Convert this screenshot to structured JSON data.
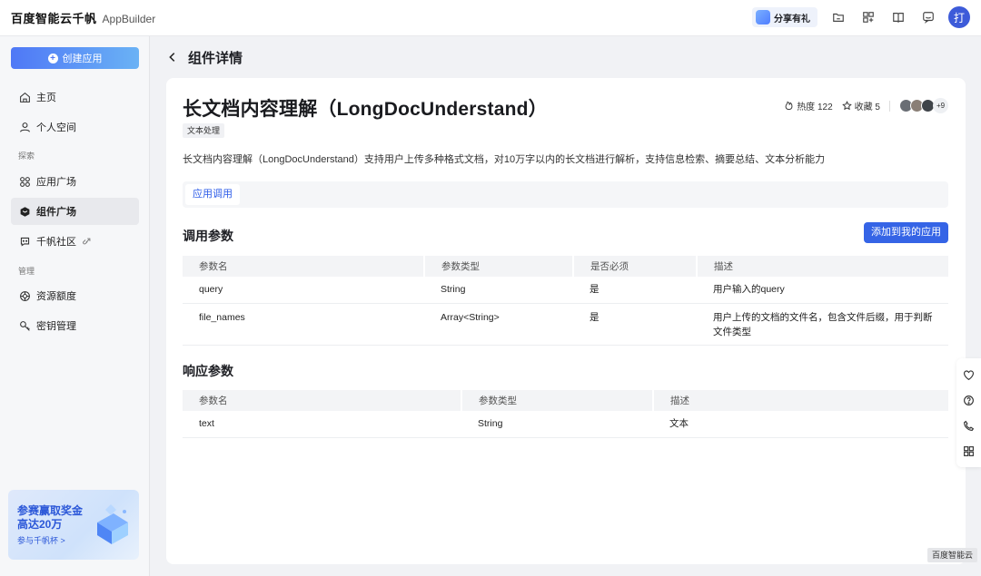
{
  "topbar": {
    "logo_main": "百度智能云千帆",
    "logo_sub": "AppBuilder",
    "share_label": "分享有礼",
    "avatar_letter": "打"
  },
  "sidebar": {
    "create_label": "创建应用",
    "items": [
      {
        "label": "主页",
        "icon": "home-icon"
      },
      {
        "label": "个人空间",
        "icon": "user-icon"
      },
      {
        "label": "应用广场",
        "icon": "apps-grid-icon"
      },
      {
        "label": "组件广场",
        "icon": "cube-icon"
      },
      {
        "label": "千帆社区",
        "icon": "community-icon"
      },
      {
        "label": "资源额度",
        "icon": "quota-icon"
      },
      {
        "label": "密钥管理",
        "icon": "key-icon"
      }
    ],
    "section_explore": "探索",
    "section_manage": "管理",
    "promo_title": "参赛赢取奖金高达20万",
    "promo_link": "参与千帆杯 >"
  },
  "page": {
    "title": "组件详情"
  },
  "component": {
    "name": "长文档内容理解（LongDocUnderstand）",
    "tag": "文本处理",
    "heat_label": "热度 122",
    "fav_label": "收藏 5",
    "more_users": "+9",
    "description": "长文档内容理解（LongDocUnderstand）支持用户上传多种格式文档，对10万字以内的长文档进行解析，支持信息检索、摘要总结、文本分析能力",
    "tab": "应用调用"
  },
  "call_params": {
    "title": "调用参数",
    "add_button": "添加到我的应用",
    "headers": [
      "参数名",
      "参数类型",
      "是否必须",
      "描述"
    ],
    "rows": [
      [
        "query",
        "String",
        "是",
        "用户输入的query"
      ],
      [
        "file_names",
        "Array<String>",
        "是",
        "用户上传的文档的文件名，包含文件后缀，用于判断文件类型"
      ]
    ]
  },
  "resp_params": {
    "title": "响应参数",
    "headers": [
      "参数名",
      "参数类型",
      "描述"
    ],
    "rows": [
      [
        "text",
        "String",
        "文本"
      ]
    ]
  },
  "footer": {
    "corner_badge": "百度智能云"
  }
}
